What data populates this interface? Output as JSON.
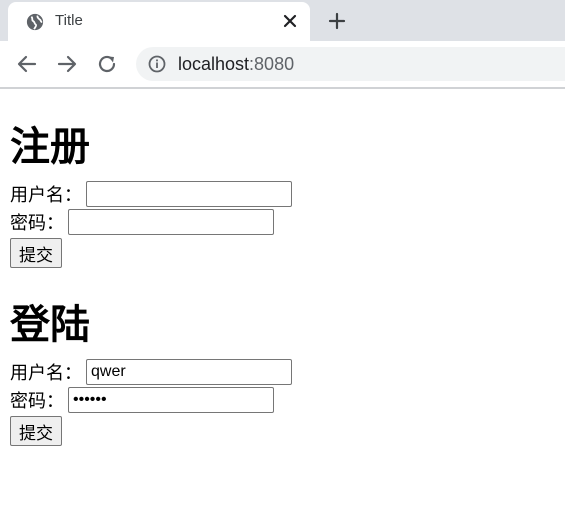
{
  "browser": {
    "tab_title": "Title",
    "url_host": "localhost",
    "url_port": ":8080",
    "icons": {
      "favicon": "globe-icon",
      "close": "close-icon",
      "new_tab": "plus-icon",
      "back": "arrow-left-icon",
      "forward": "arrow-right-icon",
      "reload": "reload-icon",
      "site_info": "info-icon"
    }
  },
  "register": {
    "heading": "注册",
    "username_label": "用户名：",
    "username_value": "",
    "password_label": "密码：",
    "password_value": "",
    "submit_label": "提交"
  },
  "login": {
    "heading": "登陆",
    "username_label": "用户名：",
    "username_value": "qwer",
    "password_label": "密码：",
    "password_value": "••••••",
    "submit_label": "提交"
  }
}
